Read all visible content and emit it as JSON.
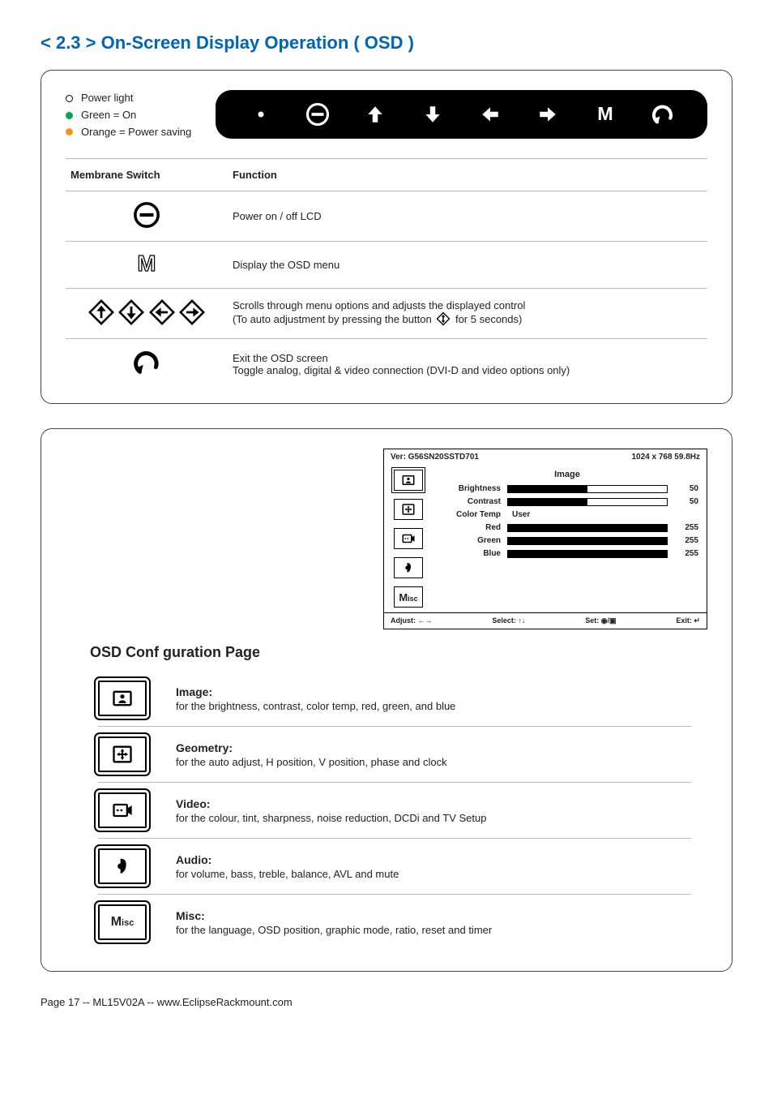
{
  "section_title": "< 2.3 > On-Screen Display Operation ( OSD )",
  "legend": {
    "power_light": "Power light",
    "green": "Green = On",
    "orange": "Orange = Power saving"
  },
  "table": {
    "headers": {
      "switch": "Membrane Switch",
      "function": "Function"
    },
    "rows": {
      "power": "Power on / off LCD",
      "menu": "Display the OSD menu",
      "scroll_line1": "Scrolls through menu options and adjusts the displayed control",
      "scroll_line2a": "(To auto adjustment by pressing the button",
      "scroll_line2b": "for 5 seconds)",
      "exit_line1": "Exit the OSD screen",
      "exit_line2": "Toggle analog, digital & video connection (DVI-D and video options only)"
    }
  },
  "osd": {
    "version": "Ver: G56SN20SSTD701",
    "resolution": "1024 x 768  59.8Hz",
    "heading": "Image",
    "rows": {
      "brightness": {
        "label": "Brightness",
        "value": "50",
        "pct": 50
      },
      "contrast": {
        "label": "Contrast",
        "value": "50",
        "pct": 50
      },
      "colortemp": {
        "label": "Color Temp",
        "value": "User"
      },
      "red": {
        "label": "Red",
        "value": "255",
        "pct": 100
      },
      "green": {
        "label": "Green",
        "value": "255",
        "pct": 100
      },
      "blue": {
        "label": "Blue",
        "value": "255",
        "pct": 100
      }
    },
    "footer": {
      "adjust": "Adjust: ←→",
      "select": "Select: ↑↓",
      "set": "Set: ◉/▣",
      "exit": "Exit: ↵"
    }
  },
  "osd_config_title": "OSD Conf guration Page",
  "categories": {
    "image": {
      "title": "Image:",
      "desc": "for the brightness, contrast, color temp, red, green, and blue"
    },
    "geometry": {
      "title": "Geometry:",
      "desc": "for the auto adjust, H position, V position, phase and clock"
    },
    "video": {
      "title": "Video:",
      "desc": "for the colour, tint, sharpness, noise reduction, DCDi and TV Setup"
    },
    "audio": {
      "title": "Audio:",
      "desc": "for volume, bass, treble, balance, AVL and mute"
    },
    "misc": {
      "title": "Misc:",
      "desc": "for the language, OSD position, graphic mode, ratio, reset and timer"
    }
  },
  "footer": "Page 17 -- ML15V02A -- www.EclipseRackmount.com"
}
